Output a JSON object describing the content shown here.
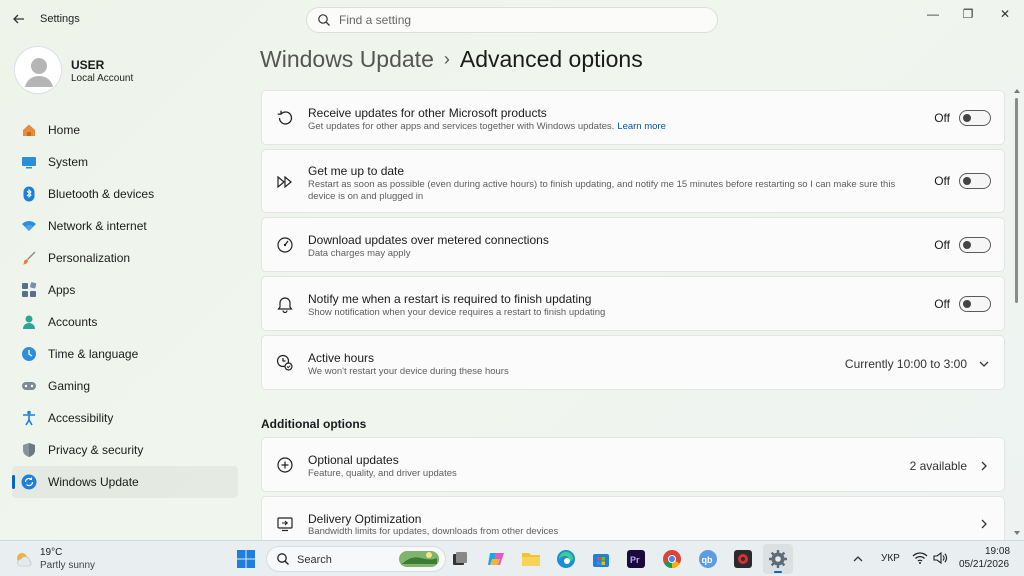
{
  "window": {
    "app_title": "Settings",
    "search_placeholder": "Find a setting",
    "controls": {
      "minimize": "—",
      "restore": "❐",
      "close": "✕"
    }
  },
  "user": {
    "name": "USER",
    "account_type": "Local Account"
  },
  "sidebar": {
    "items": [
      {
        "label": "Home",
        "icon": "home-icon"
      },
      {
        "label": "System",
        "icon": "system-icon"
      },
      {
        "label": "Bluetooth & devices",
        "icon": "bluetooth-icon"
      },
      {
        "label": "Network & internet",
        "icon": "wifi-icon"
      },
      {
        "label": "Personalization",
        "icon": "brush-icon"
      },
      {
        "label": "Apps",
        "icon": "apps-icon"
      },
      {
        "label": "Accounts",
        "icon": "accounts-icon"
      },
      {
        "label": "Time & language",
        "icon": "globe-clock-icon"
      },
      {
        "label": "Gaming",
        "icon": "gamepad-icon"
      },
      {
        "label": "Accessibility",
        "icon": "accessibility-icon"
      },
      {
        "label": "Privacy & security",
        "icon": "shield-icon"
      },
      {
        "label": "Windows Update",
        "icon": "update-icon",
        "active": true
      }
    ]
  },
  "header": {
    "parent": "Windows Update",
    "separator": "›",
    "current": "Advanced options"
  },
  "settings": [
    {
      "title": "Receive updates for other Microsoft products",
      "description": "Get updates for other apps and services together with Windows updates.",
      "link": "Learn more",
      "toggle_label": "Off",
      "enabled": false
    },
    {
      "title": "Get me up to date",
      "description": "Restart as soon as possible (even during active hours) to finish updating, and notify me 15 minutes before restarting so I can make sure this device is on and plugged in",
      "toggle_label": "Off",
      "enabled": false
    },
    {
      "title": "Download updates over metered connections",
      "description": "Data charges may apply",
      "toggle_label": "Off",
      "enabled": false
    },
    {
      "title": "Notify me when a restart is required to finish updating",
      "description": "Show notification when your device requires a restart to finish updating",
      "toggle_label": "Off",
      "enabled": false
    },
    {
      "title": "Active hours",
      "description": "We won't restart your device during these hours",
      "value": "Currently 10:00 to 3:00"
    }
  ],
  "additional": {
    "section_title": "Additional options",
    "items": [
      {
        "title": "Optional updates",
        "description": "Feature, quality, and driver updates",
        "value": "2 available"
      },
      {
        "title": "Delivery Optimization",
        "description": "Bandwidth limits for updates, downloads from other devices",
        "value": ""
      }
    ]
  },
  "taskbar": {
    "weather": {
      "temp": "19°C",
      "condition": "Partly sunny"
    },
    "search_label": "Search",
    "language": "УКР",
    "time": "19:08",
    "date": "05/21/2026",
    "colors": {
      "accent": "#0067c0"
    }
  }
}
